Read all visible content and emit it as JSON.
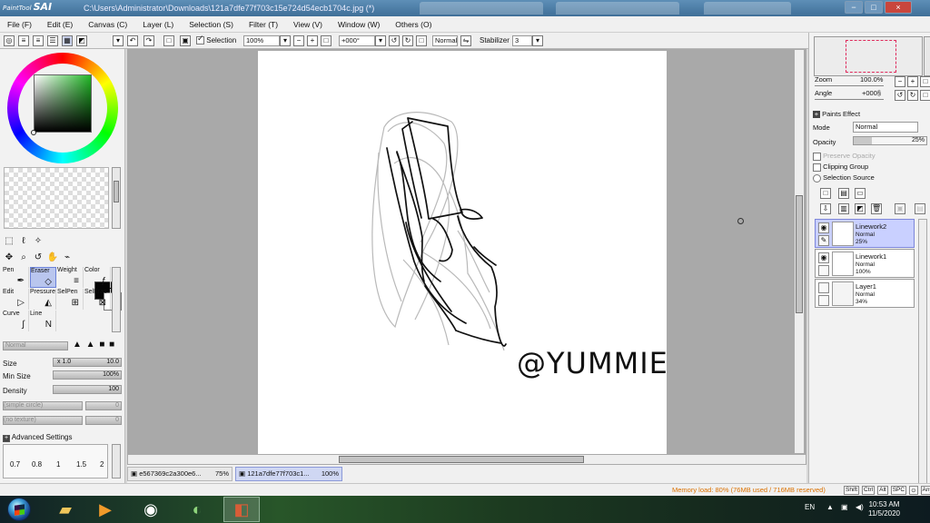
{
  "window": {
    "app_title": "SAI",
    "app_title_prefix": "PaintTool",
    "file_path": "C:\\Users\\Administrator\\Downloads\\121a7dfe77f703c15e724d54ecb1704c.jpg (*)"
  },
  "menu": [
    "File (F)",
    "Edit (E)",
    "Canvas (C)",
    "Layer (L)",
    "Selection (S)",
    "Filter (T)",
    "View (V)",
    "Window (W)",
    "Others (O)"
  ],
  "toolbar": {
    "selection_label": "Selection",
    "zoom": "100%",
    "angle": "+000°",
    "blend": "Normal",
    "stabilizer_label": "Stabilizer",
    "stabilizer_value": "3"
  },
  "tools": {
    "brushes": [
      {
        "name": "Pen",
        "icon": "pen-icon"
      },
      {
        "name": "Eraser",
        "icon": "eraser-icon"
      },
      {
        "name": "Weight",
        "icon": "weight-icon"
      },
      {
        "name": "Color",
        "icon": "color-icon"
      },
      {
        "name": "Edit",
        "icon": "edit-icon"
      },
      {
        "name": "Pressure",
        "icon": "pressure-icon"
      },
      {
        "name": "SelPen",
        "icon": "selpen-icon"
      },
      {
        "name": "SelEras",
        "icon": "seleras-icon"
      },
      {
        "name": "Curve",
        "icon": "curve-icon"
      },
      {
        "name": "Line",
        "icon": "line-icon"
      }
    ],
    "blend_mode": "Normal",
    "size_label": "Size",
    "size_multiplier": "x 1.0",
    "size_value": "10.0",
    "min_size_label": "Min Size",
    "min_size_value": "100%",
    "density_label": "Density",
    "density_value": "100",
    "simple_circle": "(simple circle)",
    "simple_circle_value": "0",
    "no_texture": "(no texture)",
    "no_texture_value": "0",
    "advanced_settings": "Advanced Settings",
    "advanced_values": [
      "0.7",
      "0.8",
      "1",
      "1.5",
      "2"
    ]
  },
  "canvas": {
    "watermark": "@YUMMIE",
    "tabs": [
      {
        "name": "e567369c2a300e6...",
        "zoom": "75%"
      },
      {
        "name": "121a7dfe77f703c1...",
        "zoom": "100%"
      }
    ]
  },
  "navigator": {
    "zoom_label": "Zoom",
    "zoom_value": "100.0%",
    "angle_label": "Angle",
    "angle_value": "+000§"
  },
  "layers_panel": {
    "paints_effect": "Paints Effect",
    "mode_label": "Mode",
    "mode_value": "Normal",
    "opacity_label": "Opacity",
    "opacity_value": "25%",
    "preserve_opacity": "Preserve Opacity",
    "clipping_group": "Clipping Group",
    "selection_source": "Selection Source",
    "layers": [
      {
        "name": "Linework2",
        "mode": "Normal",
        "opacity": "25%"
      },
      {
        "name": "Linework1",
        "mode": "Normal",
        "opacity": "100%"
      },
      {
        "name": "Layer1",
        "mode": "Normal",
        "opacity": "34%"
      }
    ]
  },
  "status": {
    "memory": "Memory load: 80% (76MB used / 716MB reserved)",
    "keys": [
      "Shift",
      "Ctrl",
      "Alt",
      "SPC",
      "⊙",
      "Any"
    ]
  },
  "taskbar": {
    "language": "EN",
    "time": "10:53 AM",
    "date": "11/5/2020"
  },
  "colors": {
    "selection_blue": "#b9c6ee",
    "active_layer": "#c9d0ff",
    "memory_orange": "#db7100",
    "canvas_gray": "#a9a9a9"
  }
}
